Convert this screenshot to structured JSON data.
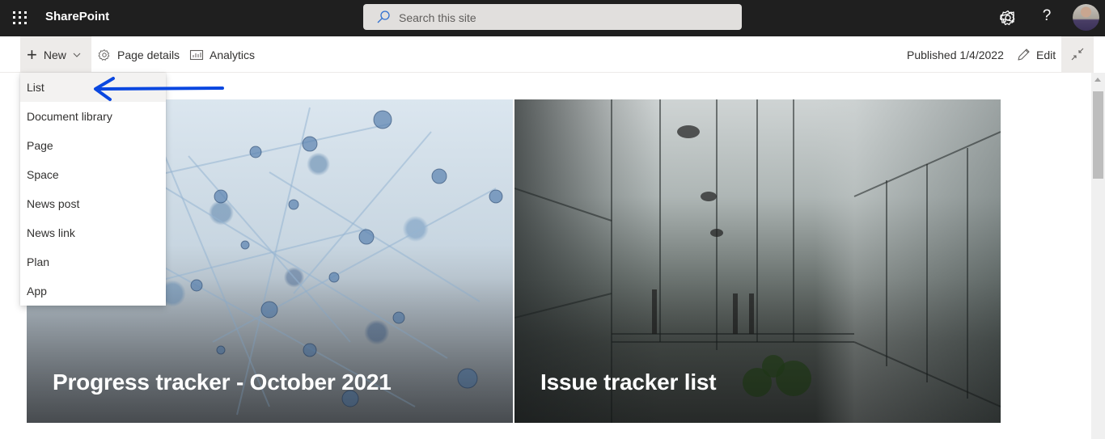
{
  "suitebar": {
    "app_name": "SharePoint",
    "search_placeholder": "Search this site",
    "icons": [
      "app-launcher-icon",
      "megaphone-icon",
      "settings-icon",
      "help-icon",
      "avatar"
    ],
    "help_glyph": "?"
  },
  "commandbar": {
    "new_label": "New",
    "page_details_label": "Page details",
    "analytics_label": "Analytics",
    "published_text": "Published 1/4/2022",
    "edit_label": "Edit"
  },
  "new_menu": {
    "items": [
      {
        "label": "List",
        "highlighted": true
      },
      {
        "label": "Document library"
      },
      {
        "label": "Page"
      },
      {
        "label": "Space"
      },
      {
        "label": "News post"
      },
      {
        "label": "News link"
      },
      {
        "label": "Plan"
      },
      {
        "label": "App"
      }
    ]
  },
  "hero": {
    "tiles": [
      {
        "title": "Progress tracker - October 2021",
        "image": "abstract-molecular-network"
      },
      {
        "title": "Issue tracker list",
        "image": "glass-atrium-office"
      }
    ]
  },
  "annotation": {
    "arrow_color": "#0a47e0",
    "points_to": "List"
  },
  "colors": {
    "suitebar_bg": "#1f1f1f",
    "search_bg": "#e1dfdd",
    "command_active_bg": "#edebe9",
    "text_primary": "#323130"
  }
}
